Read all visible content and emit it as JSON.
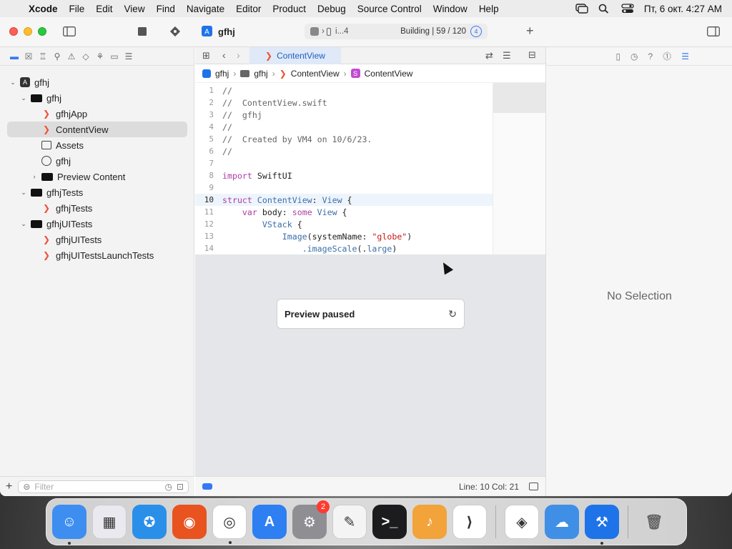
{
  "menubar": {
    "items": [
      "Xcode",
      "File",
      "Edit",
      "View",
      "Find",
      "Navigate",
      "Editor",
      "Product",
      "Debug",
      "Source Control",
      "Window",
      "Help"
    ],
    "clock": "Пт, 6 окт.  4:27 AM"
  },
  "toolbar": {
    "project_title": "gfhj",
    "scheme_text": "i...4",
    "build_status": "Building | 59 / 120",
    "issue_count": "4",
    "add_label": "+"
  },
  "navigator": {
    "tree": [
      {
        "label": "gfhj",
        "kind": "project",
        "level": 0,
        "disclosure": "open"
      },
      {
        "label": "gfhj",
        "kind": "folder",
        "level": 1,
        "disclosure": "open"
      },
      {
        "label": "gfhjApp",
        "kind": "swift",
        "level": 2
      },
      {
        "label": "ContentView",
        "kind": "swift",
        "level": 2,
        "selected": true
      },
      {
        "label": "Assets",
        "kind": "assets",
        "level": 2
      },
      {
        "label": "gfhj",
        "kind": "entitlements",
        "level": 2
      },
      {
        "label": "Preview Content",
        "kind": "folder",
        "level": 2,
        "disclosure": "closed"
      },
      {
        "label": "gfhjTests",
        "kind": "folder",
        "level": 1,
        "disclosure": "open"
      },
      {
        "label": "gfhjTests",
        "kind": "swift",
        "level": 2
      },
      {
        "label": "gfhjUITests",
        "kind": "folder",
        "level": 1,
        "disclosure": "open"
      },
      {
        "label": "gfhjUITests",
        "kind": "swift",
        "level": 2
      },
      {
        "label": "gfhjUITestsLaunchTests",
        "kind": "swift",
        "level": 2
      }
    ],
    "filter_placeholder": "Filter"
  },
  "editor": {
    "active_tab": "ContentView",
    "breadcrumb": [
      "gfhj",
      "gfhj",
      "ContentView",
      "ContentView"
    ],
    "code_lines": [
      {
        "n": "1",
        "tokens": [
          [
            "cm",
            "//"
          ]
        ]
      },
      {
        "n": "2",
        "tokens": [
          [
            "cm",
            "//  ContentView.swift"
          ]
        ]
      },
      {
        "n": "3",
        "tokens": [
          [
            "cm",
            "//  gfhj"
          ]
        ]
      },
      {
        "n": "4",
        "tokens": [
          [
            "cm",
            "//"
          ]
        ]
      },
      {
        "n": "5",
        "tokens": [
          [
            "cm",
            "//  Created by VM4 on 10/6/23."
          ]
        ]
      },
      {
        "n": "6",
        "tokens": [
          [
            "cm",
            "//"
          ]
        ]
      },
      {
        "n": "7",
        "tokens": []
      },
      {
        "n": "8",
        "tokens": [
          [
            "kw",
            "import"
          ],
          [
            "pl",
            " SwiftUI"
          ]
        ]
      },
      {
        "n": "9",
        "tokens": []
      },
      {
        "n": "10",
        "current": true,
        "tokens": [
          [
            "kw",
            "struct"
          ],
          [
            "pl",
            " "
          ],
          [
            "ty",
            "ContentView"
          ],
          [
            "pl",
            ": "
          ],
          [
            "ty",
            "View"
          ],
          [
            "pl",
            " {"
          ]
        ]
      },
      {
        "n": "11",
        "tokens": [
          [
            "pl",
            "    "
          ],
          [
            "kw",
            "var"
          ],
          [
            "pl",
            " body: "
          ],
          [
            "kw",
            "some"
          ],
          [
            "pl",
            " "
          ],
          [
            "ty",
            "View"
          ],
          [
            "pl",
            " {"
          ]
        ]
      },
      {
        "n": "12",
        "tokens": [
          [
            "pl",
            "        "
          ],
          [
            "ty",
            "VStack"
          ],
          [
            "pl",
            " {"
          ]
        ]
      },
      {
        "n": "13",
        "tokens": [
          [
            "pl",
            "            "
          ],
          [
            "ty",
            "Image"
          ],
          [
            "pl",
            "(systemName: "
          ],
          [
            "str",
            "\"globe\""
          ],
          [
            "pl",
            ")"
          ]
        ]
      },
      {
        "n": "14",
        "tokens": [
          [
            "pl",
            "                "
          ],
          [
            "ty",
            ".imageScale"
          ],
          [
            "pl",
            "(."
          ],
          [
            "ty",
            "large"
          ],
          [
            "pl",
            ")"
          ]
        ]
      }
    ],
    "preview_message": "Preview paused",
    "cursor_position": "Line: 10  Col: 21"
  },
  "inspector": {
    "empty_text": "No Selection"
  },
  "dock": {
    "apps": [
      {
        "name": "Finder",
        "color": "#3d8ef0",
        "glyph": "☺",
        "running": true
      },
      {
        "name": "Launchpad",
        "color": "#e9e9ef",
        "glyph": "▦"
      },
      {
        "name": "Safari",
        "color": "#2a8fe8",
        "glyph": "✪"
      },
      {
        "name": "Firefox",
        "color": "#e8531f",
        "glyph": "◉"
      },
      {
        "name": "Chrome",
        "color": "#ffffff",
        "glyph": "◎",
        "running": true
      },
      {
        "name": "App Store",
        "color": "#2d7ff2",
        "glyph": "A"
      },
      {
        "name": "System Settings",
        "color": "#8e8e93",
        "glyph": "⚙",
        "badge": "2"
      },
      {
        "name": "TextEdit",
        "color": "#f4f4f4",
        "glyph": "✎"
      },
      {
        "name": "Terminal",
        "color": "#1c1c1e",
        "glyph": ">_"
      },
      {
        "name": "Instruments",
        "color": "#f2a33a",
        "glyph": "♪"
      },
      {
        "name": "Visual Studio Code",
        "color": "#ffffff",
        "glyph": "⟩"
      },
      {
        "name": "Visual Studio",
        "color": "#ffffff",
        "glyph": "◈"
      },
      {
        "name": "Weather",
        "color": "#3f8fe6",
        "glyph": "☁"
      },
      {
        "name": "Xcode",
        "color": "#1f73e8",
        "glyph": "⚒",
        "running": true
      }
    ],
    "trash": {
      "name": "Trash",
      "glyph": "🗑"
    }
  }
}
